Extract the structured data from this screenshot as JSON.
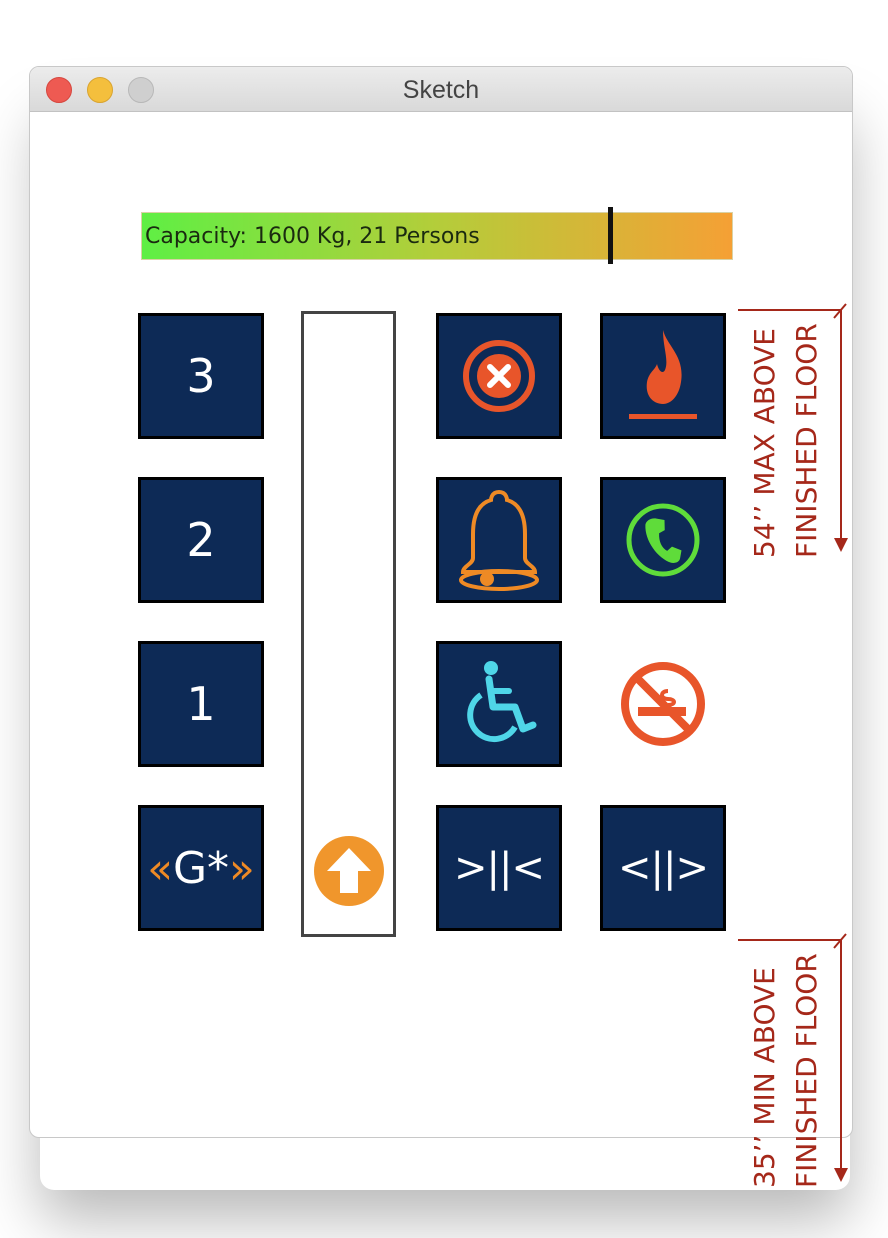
{
  "window": {
    "title": "Sketch",
    "controls": [
      "close",
      "minimize",
      "maximize"
    ]
  },
  "capacity": {
    "label": "Capacity: 1600 Kg, 21 Persons",
    "load_fraction": 0.79
  },
  "floor_buttons": [
    {
      "label": "3"
    },
    {
      "label": "2"
    },
    {
      "label": "1"
    }
  ],
  "ground_button": {
    "arrow_left": "«",
    "label": "G*",
    "arrow_right": "»"
  },
  "shaft": {
    "car_icon": "up-arrow-circle-icon",
    "car_position_fraction": 0.0
  },
  "function_buttons": [
    {
      "icon": "cancel-x-circle-icon",
      "color": "#e8552a"
    },
    {
      "icon": "fire-icon",
      "color": "#e8552a"
    },
    {
      "icon": "alarm-bell-icon",
      "color": "#ee8a25"
    },
    {
      "icon": "phone-icon",
      "color": "#5fdc3a"
    },
    {
      "icon": "wheelchair-icon",
      "color": "#4fd6e8"
    },
    {
      "icon": "no-smoking-icon",
      "color": "#e8552a"
    }
  ],
  "door_buttons": {
    "close_label": ">||<",
    "open_label": "<||>"
  },
  "annotations": {
    "max_height_line1": "54’’ MAX ABOVE",
    "max_height_line2": "FINISHED FLOOR",
    "min_height_line1": "35’’ MIN ABOVE",
    "min_height_line2": "FINISHED FLOOR",
    "color": "#a5281a"
  },
  "colors": {
    "button_bg": "#0d2a56",
    "capacity_gradient": [
      "#5fef44",
      "#b4cd3a",
      "#f5a035"
    ]
  }
}
